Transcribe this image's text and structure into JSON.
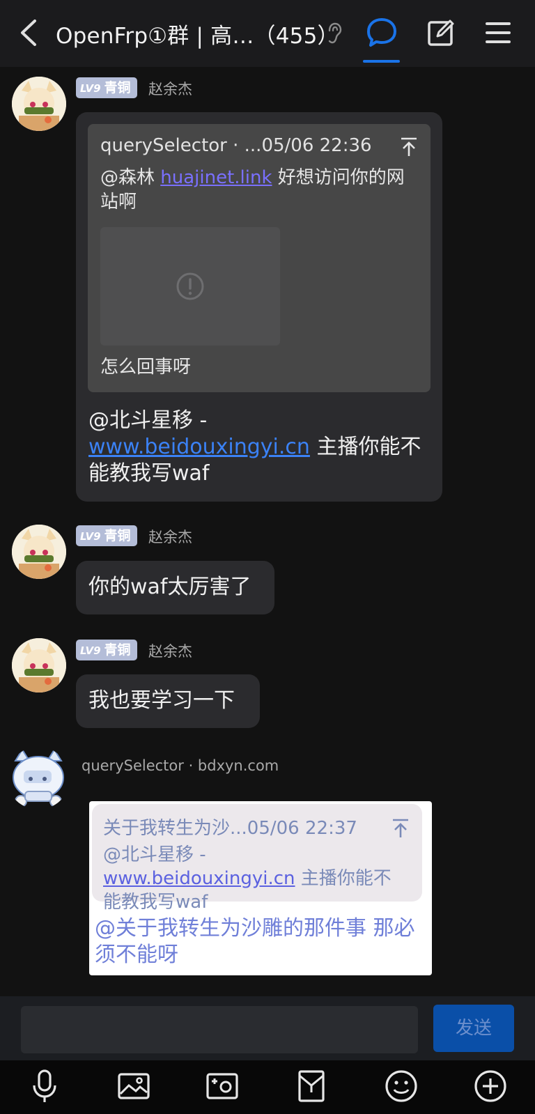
{
  "header": {
    "title": "OpenFrp①群 | 高…（455）"
  },
  "messages": [
    {
      "badge_level": "LV9",
      "badge_rank": "青铜",
      "sender": "赵余杰",
      "quote": {
        "author_time": "querySelector · ...05/06 22:36",
        "text_prefix": "@森林 ",
        "link": "huajinet.link",
        "text_suffix": " 好想访问你的网站啊",
        "footer": "怎么回事呀"
      },
      "text_prefix": "@北斗星移 - ",
      "link": "www.beidouxingyi.cn",
      "text_suffix": " 主播你能不能教我写waf"
    },
    {
      "badge_level": "LV9",
      "badge_rank": "青铜",
      "sender": "赵余杰",
      "text": "你的waf太厉害了"
    },
    {
      "badge_level": "LV9",
      "badge_rank": "青铜",
      "sender": "赵余杰",
      "text": "我也要学习一下"
    },
    {
      "sender": "querySelector · bdxyn.com",
      "quote": {
        "author_time": "关于我转生为沙...05/06 22:37",
        "text_prefix": "@北斗星移 - ",
        "link": "www.beidouxingyi.cn",
        "text_suffix": " 主播你能不能教我写waf"
      },
      "text": "@关于我转生为沙雕的那件事 那必须不能呀"
    }
  ],
  "input": {
    "value": "",
    "send_label": "发送"
  },
  "toolbar": {
    "icons": [
      "microphone-icon",
      "image-icon",
      "camera-icon",
      "file-icon",
      "emoji-icon",
      "plus-icon"
    ]
  },
  "colors": {
    "accent": "#1a73e8",
    "badge": "#b4bdd8",
    "bubble": "#2b2b2e",
    "send_button": "#0a4fa8"
  }
}
